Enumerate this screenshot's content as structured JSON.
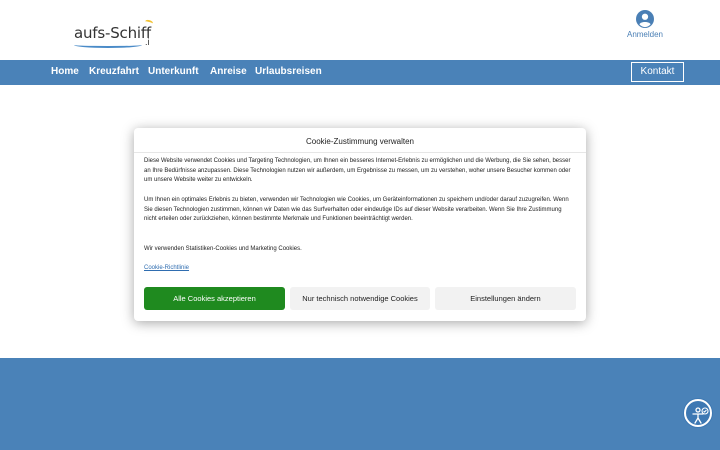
{
  "header": {
    "logo_text": "aufs-Schiff",
    "logo_suffix": ".i",
    "login_label": "Anmelden"
  },
  "nav": {
    "items": [
      "Home",
      "Kreuzfahrt",
      "Unterkunft",
      "Anreise",
      "Urlaubsreisen"
    ],
    "contact_label": "Kontakt"
  },
  "cookie_modal": {
    "title": "Cookie-Zustimmung verwalten",
    "paragraph_1": "Diese Website verwendet Cookies und Targeting Technologien, um Ihnen ein besseres Internet-Erlebnis zu ermöglichen und die Werbung, die Sie sehen, besser an Ihre Bedürfnisse anzupassen. Diese Technologien nutzen wir außerdem, um Ergebnisse zu messen, um zu verstehen, woher unsere Besucher kommen oder um unsere Website weiter zu entwickeln.",
    "paragraph_2": "Um Ihnen ein optimales Erlebnis zu bieten, verwenden wir Technologien wie Cookies, um Geräteinformationen zu speichern und/oder darauf zuzugreifen. Wenn Sie diesen Technologien zustimmen, können wir Daten wie das Surfverhalten oder eindeutige IDs auf dieser Website verarbeiten. Wenn Sie Ihre Zustimmung nicht erteilen oder zurückziehen, können bestimmte Merkmale und Funktionen beeinträchtigt werden.",
    "paragraph_3": "Wir verwenden Statistiken-Cookies und Marketing Cookies.",
    "link_label": "Cookie-Richtlinie",
    "accept_label": "Alle Cookies akzeptieren",
    "technical_label": "Nur technisch notwendige Cookies",
    "settings_label": "Einstellungen ändern"
  },
  "colors": {
    "brand_blue": "#4a82b8",
    "accept_green": "#1f8a1f",
    "link_blue": "#2f6db0"
  },
  "icons": {
    "login": "user-circle-icon",
    "accessibility": "accessibility-icon"
  }
}
